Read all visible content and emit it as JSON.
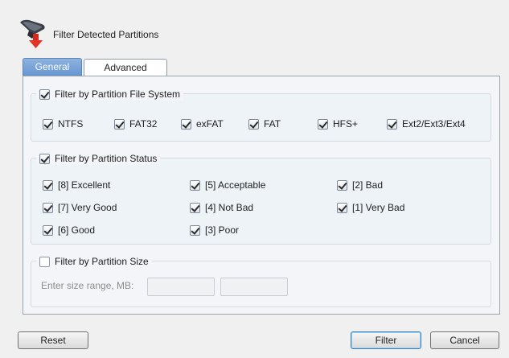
{
  "header": {
    "title": "Filter Detected Partitions",
    "icon": "filter-funnel-icon"
  },
  "tabs": [
    {
      "label": "General",
      "selected": true
    },
    {
      "label": "Advanced",
      "selected": false
    }
  ],
  "file_system": {
    "label": "Filter by Partition File System",
    "checked": true,
    "items": [
      {
        "label": "NTFS",
        "checked": true
      },
      {
        "label": "FAT32",
        "checked": true
      },
      {
        "label": "exFAT",
        "checked": true
      },
      {
        "label": "FAT",
        "checked": true
      },
      {
        "label": "HFS+",
        "checked": true
      },
      {
        "label": "Ext2/Ext3/Ext4",
        "checked": true
      }
    ]
  },
  "status": {
    "label": "Filter by Partition Status",
    "checked": true,
    "items": [
      {
        "label": "[8] Excellent",
        "checked": true
      },
      {
        "label": "[5] Acceptable",
        "checked": true
      },
      {
        "label": "[2] Bad",
        "checked": true
      },
      {
        "label": "[7] Very Good",
        "checked": true
      },
      {
        "label": "[4] Not Bad",
        "checked": true
      },
      {
        "label": "[1] Very Bad",
        "checked": true
      },
      {
        "label": "[6] Good",
        "checked": true
      },
      {
        "label": "[3] Poor",
        "checked": true
      }
    ]
  },
  "size": {
    "label": "Filter by Partition Size",
    "checked": false,
    "range_label": "Enter size range, MB:",
    "min_value": "",
    "max_value": ""
  },
  "buttons": {
    "reset": "Reset",
    "filter": "Filter",
    "cancel": "Cancel"
  },
  "colors": {
    "tab_selected": "#6494d0",
    "default_button_border": "#3c7fb1"
  }
}
